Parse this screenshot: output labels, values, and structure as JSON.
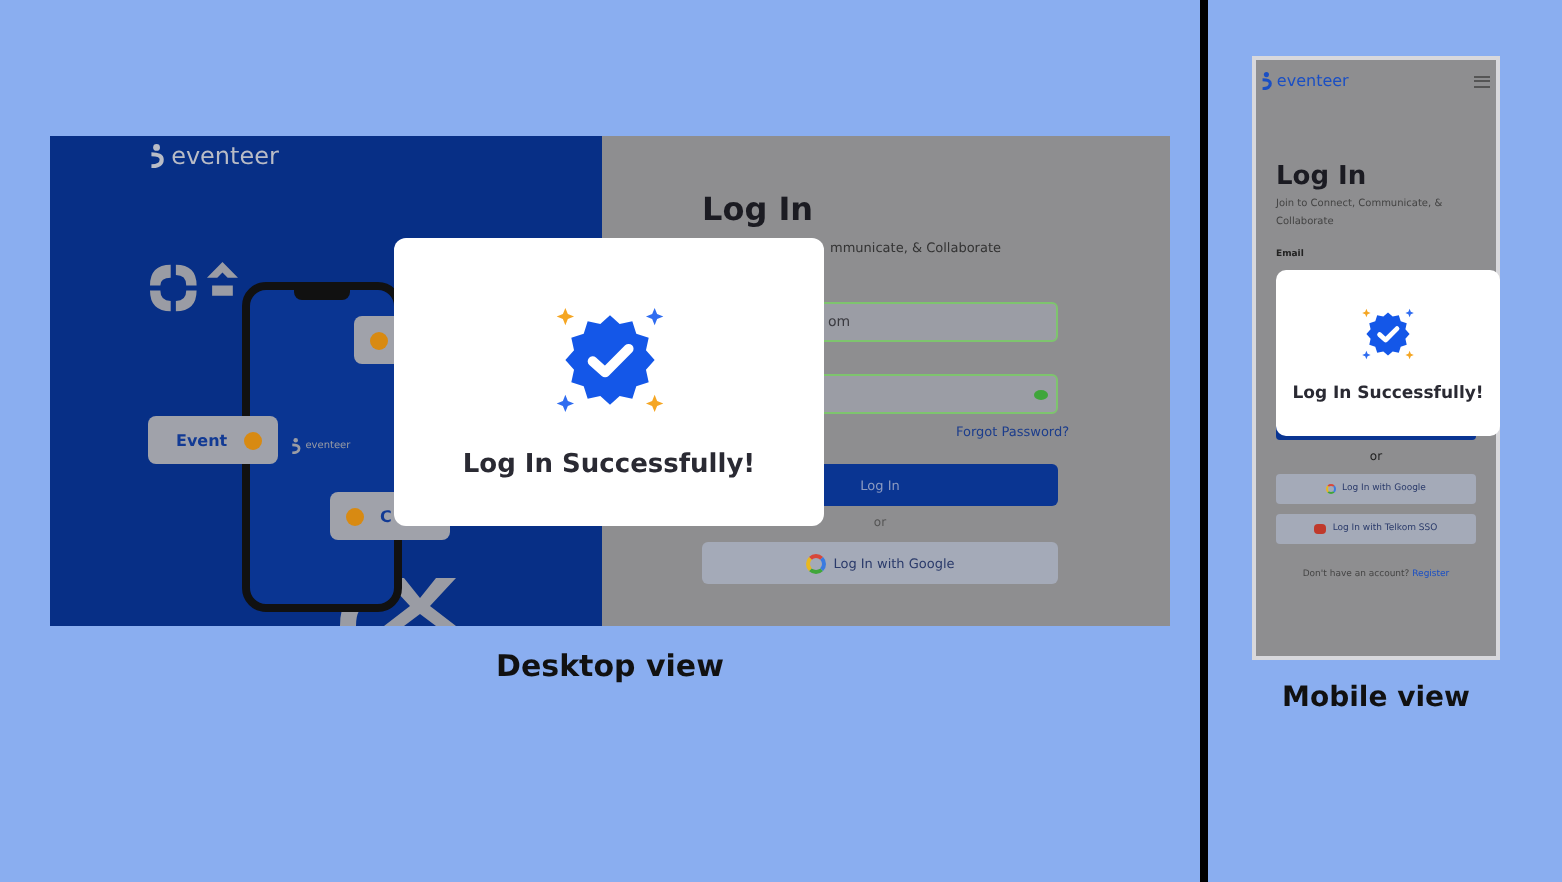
{
  "desktop": {
    "caption": "Desktop view",
    "brand": "eventeer",
    "chips": [
      {
        "kind": "dot-only"
      },
      {
        "kind": "labelled",
        "label": "Event"
      },
      {
        "kind": "labelled",
        "label": "C"
      }
    ],
    "phone_brand": "eventeer",
    "heading": "Log In",
    "subtitle": "mmunicate, & Collaborate",
    "email_value": "om",
    "forgot": "Forgot Password?",
    "login_button": "Log In",
    "divider": "or",
    "google_button": "Log In with Google",
    "modal": {
      "message": "Log In Successfully!"
    }
  },
  "mobile": {
    "caption": "Mobile view",
    "brand": "eventeer",
    "heading": "Log In",
    "subtitle": "Join to Connect, Communicate, & Collaborate",
    "email_label": "Email",
    "divider": "or",
    "google_button": "Log In with Google",
    "sso_button": "Log In with Telkom SSO",
    "register_prompt": "Don't have an account?",
    "register_link": "Register",
    "modal": {
      "message": "Log In Successfully!"
    }
  }
}
